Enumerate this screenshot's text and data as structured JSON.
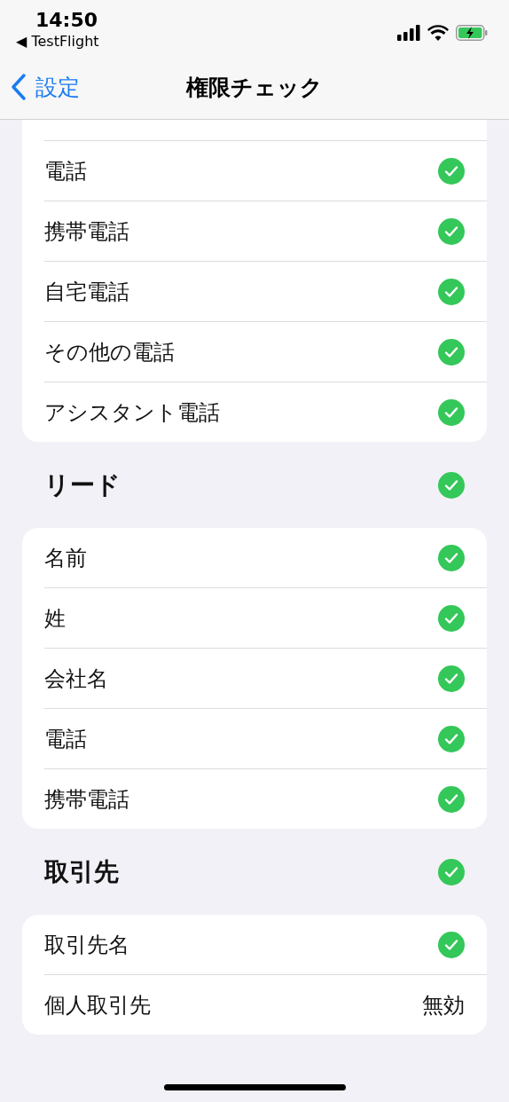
{
  "status_bar": {
    "time": "14:50",
    "back_app": "◀ TestFlight"
  },
  "nav": {
    "back": "設定",
    "title": "権限チェック"
  },
  "sections": [
    {
      "items": [
        {
          "label": "電話",
          "kind": "check",
          "checked": true
        },
        {
          "label": "携帯電話",
          "kind": "check",
          "checked": true
        },
        {
          "label": "自宅電話",
          "kind": "check",
          "checked": true
        },
        {
          "label": "その他の電話",
          "kind": "check",
          "checked": true
        },
        {
          "label": "アシスタント電話",
          "kind": "check",
          "checked": true
        }
      ],
      "partial_top": true
    },
    {
      "title": "リード",
      "checked": true,
      "items": [
        {
          "label": "名前",
          "kind": "check",
          "checked": true
        },
        {
          "label": "姓",
          "kind": "check",
          "checked": true
        },
        {
          "label": "会社名",
          "kind": "check",
          "checked": true
        },
        {
          "label": "電話",
          "kind": "check",
          "checked": true
        },
        {
          "label": "携帯電話",
          "kind": "check",
          "checked": true
        }
      ]
    },
    {
      "title": "取引先",
      "checked": true,
      "items": [
        {
          "label": "取引先名",
          "kind": "check",
          "checked": true
        },
        {
          "label": "個人取引先",
          "kind": "text",
          "value": "無効"
        }
      ]
    }
  ]
}
